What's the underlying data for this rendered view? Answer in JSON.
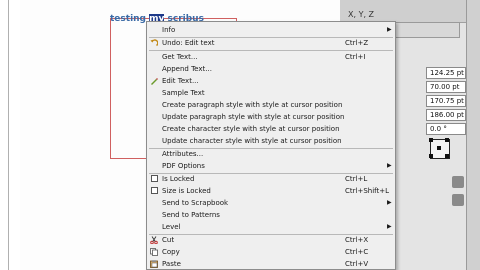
{
  "document": {
    "text_before": "testing ",
    "text_selected": "my",
    "text_after": " scribus"
  },
  "panel": {
    "title": "X, Y, Z",
    "fields": [
      "124.25 pt",
      "70.00 pt",
      "170.75 pt",
      "186.00 pt",
      "0.0 °"
    ]
  },
  "menu": {
    "info": "Info",
    "undo_label": "Undo: Edit text",
    "undo_shortcut": "Ctrl+Z",
    "get_text": "Get Text...",
    "get_text_shortcut": "Ctrl+I",
    "append_text": "Append Text...",
    "edit_text": "Edit Text...",
    "sample_text": "Sample Text",
    "create_para_style": "Create paragraph style with style at cursor position",
    "update_para_style": "Update paragraph style with style at cursor position",
    "create_char_style": "Create character style with style at cursor position",
    "update_char_style": "Update character style with style at cursor position",
    "attributes": "Attributes...",
    "pdf_options": "PDF Options",
    "is_locked": "Is Locked",
    "is_locked_shortcut": "Ctrl+L",
    "size_locked": "Size is Locked",
    "size_locked_shortcut": "Ctrl+Shift+L",
    "send_scrapbook": "Send to Scrapbook",
    "send_patterns": "Send to Patterns",
    "level": "Level",
    "cut": "Cut",
    "cut_shortcut": "Ctrl+X",
    "copy": "Copy",
    "copy_shortcut": "Ctrl+C",
    "paste": "Paste",
    "paste_shortcut": "Ctrl+V"
  },
  "colors": {
    "menu_bg": "#efefef",
    "selection": "#1e3a8a",
    "frame_border": "#d06060",
    "doc_text": "#3a6aa6"
  },
  "icons": {
    "undo": "undo-icon",
    "edit_text": "edit-text-icon",
    "cut": "scissors-icon",
    "copy": "copy-icon",
    "paste": "paste-icon"
  }
}
